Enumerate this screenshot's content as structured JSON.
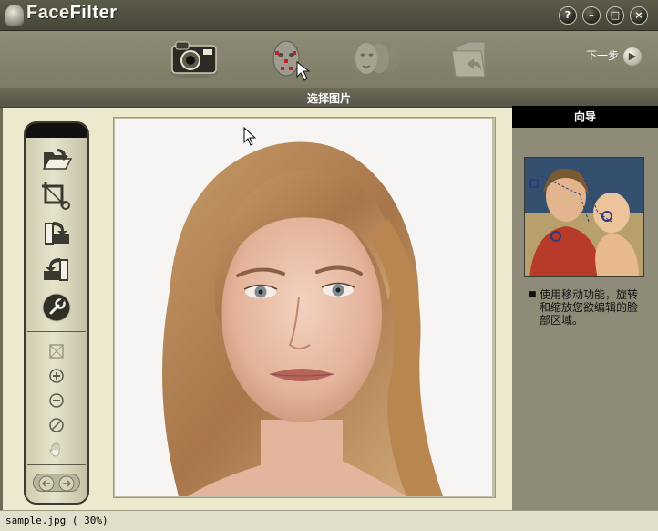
{
  "window": {
    "app_name_part1": "Face",
    "app_name_part2": "Filter",
    "buttons": [
      {
        "name": "help",
        "glyph": "?"
      },
      {
        "name": "minimize",
        "glyph": "–"
      },
      {
        "name": "maximize",
        "glyph": "□"
      },
      {
        "name": "close",
        "glyph": "×"
      }
    ]
  },
  "toolbar": {
    "steps": [
      {
        "name": "select-picture",
        "icon": "camera-icon",
        "active": true
      },
      {
        "name": "define-face",
        "icon": "face-points-icon",
        "active": false
      },
      {
        "name": "edit-face",
        "icon": "faces-icon",
        "active": false
      },
      {
        "name": "save",
        "icon": "folder-return-icon",
        "active": false
      }
    ],
    "next_label": "下一步",
    "next_icon": "arrow-right-icon"
  },
  "section": {
    "title": "选择图片"
  },
  "tools": {
    "main": [
      {
        "name": "open-image",
        "icon": "folder-open-icon"
      },
      {
        "name": "crop",
        "icon": "crop-icon"
      },
      {
        "name": "rotate-right",
        "icon": "rotate-right-icon"
      },
      {
        "name": "rotate-left",
        "icon": "rotate-left-icon"
      },
      {
        "name": "settings",
        "icon": "wrench-icon"
      }
    ],
    "view": [
      {
        "name": "fit",
        "icon": "fit-window-icon"
      },
      {
        "name": "zoom-in",
        "icon": "zoom-in-icon"
      },
      {
        "name": "zoom-out",
        "icon": "zoom-out-icon"
      },
      {
        "name": "reset",
        "icon": "no-icon"
      },
      {
        "name": "pan",
        "icon": "hand-icon"
      }
    ],
    "nav": [
      "undo-arrow-icon",
      "redo-arrow-icon"
    ]
  },
  "guide": {
    "title": "向导",
    "thumbnail_icon": "face-guide-image",
    "bullet": "■",
    "text": "使用移动功能，旋转和缩放您欲编辑的脸部区域。"
  },
  "status": {
    "text": "sample.jpg  ( 30%)"
  },
  "colors": {
    "title_bar": "#474637",
    "toolbar": "#8e8c76",
    "main_bg": "#ece9cf",
    "guide_bg": "#8e8c78",
    "section_bar": "#57564a"
  }
}
